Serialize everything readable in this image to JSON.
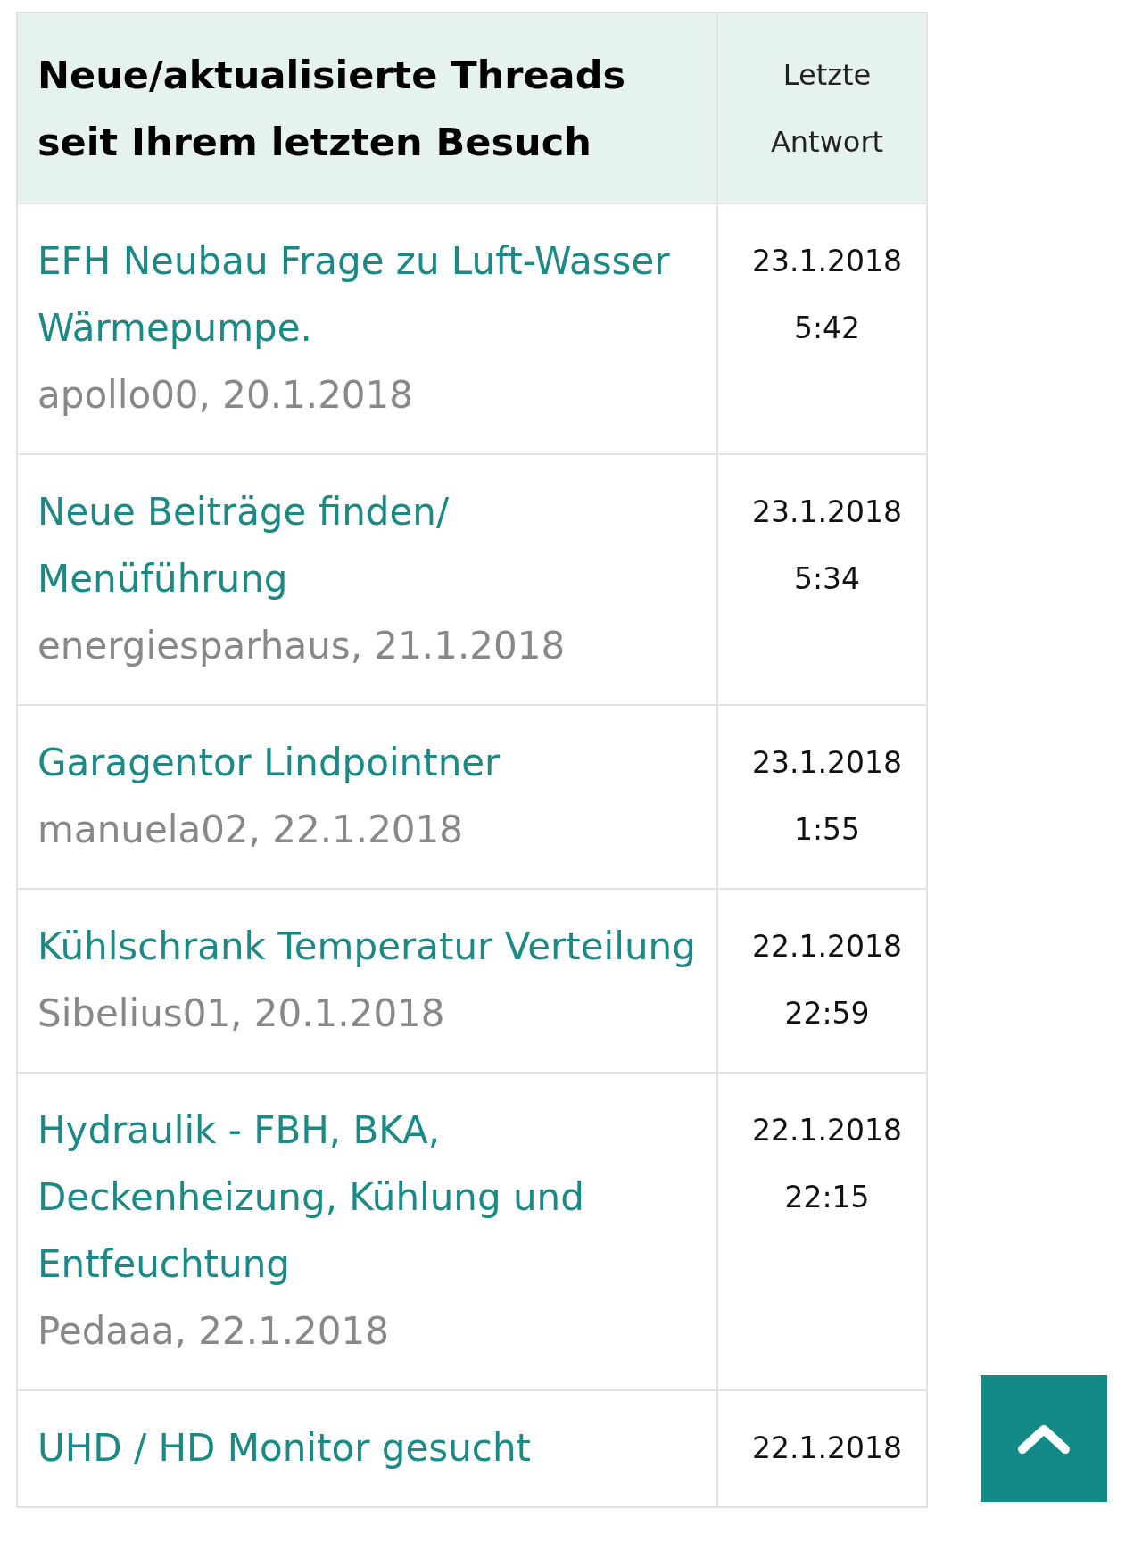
{
  "table": {
    "columns": [
      "Neue/aktualisierte Threads seit Ihrem letzten Besuch",
      "Letzte Antwort"
    ],
    "rows": [
      {
        "title": "EFH Neubau Frage zu Luft-Wasser Wärmepumpe.",
        "meta": "apollo00, 20.1.2018",
        "last_reply": "23.1.2018 5:42"
      },
      {
        "title": "Neue Beiträge finden/ Menüführung",
        "meta": "energiesparhaus, 21.1.2018",
        "last_reply": "23.1.2018 5:34"
      },
      {
        "title": "Garagentor Lindpointner",
        "meta": "manuela02, 22.1.2018",
        "last_reply": "23.1.2018 1:55"
      },
      {
        "title": "Kühlschrank Temperatur Verteilung",
        "meta": "Sibelius01, 20.1.2018",
        "last_reply": "22.1.2018 22:59"
      },
      {
        "title": "Hydraulik - FBH, BKA, Deckenheizung, Kühlung und Entfeuchtung",
        "meta": "Pedaaa, 22.1.2018",
        "last_reply": "22.1.2018 22:15"
      },
      {
        "title": "UHD / HD Monitor gesucht",
        "last_reply": "22.1.2018"
      }
    ]
  }
}
